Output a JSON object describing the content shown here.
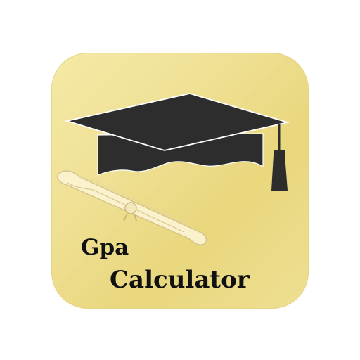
{
  "icon": {
    "title_line1": "Gpa",
    "title_line2": "Calculator",
    "images": [
      "graduation-cap-icon",
      "diploma-scroll-icon"
    ]
  },
  "colors": {
    "background_gold": "#efe094",
    "cap": "#2b2b2b",
    "scroll": "#fbf1cc",
    "text": "#111111"
  }
}
